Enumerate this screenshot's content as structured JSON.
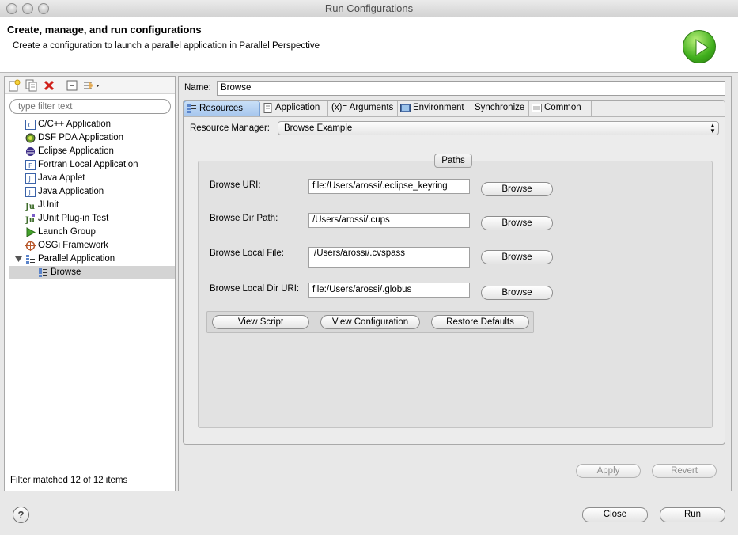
{
  "window": {
    "title": "Run Configurations"
  },
  "header": {
    "title": "Create, manage, and run configurations",
    "subtitle": "Create a configuration to launch a parallel application in Parallel Perspective",
    "icon": "run-play-icon"
  },
  "left": {
    "toolbar": {
      "icons": [
        "new-config-icon",
        "duplicate-icon",
        "delete-icon",
        "collapse-all-icon",
        "filter-menu-icon"
      ]
    },
    "filter_placeholder": "type filter text",
    "tree": [
      {
        "label": "C/C++ Application",
        "icon": "c-app-icon"
      },
      {
        "label": "DSF PDA Application",
        "icon": "dsf-pda-icon"
      },
      {
        "label": "Eclipse Application",
        "icon": "eclipse-icon"
      },
      {
        "label": "Fortran Local Application",
        "icon": "fortran-icon"
      },
      {
        "label": "Java Applet",
        "icon": "java-applet-icon"
      },
      {
        "label": "Java Application",
        "icon": "java-app-icon"
      },
      {
        "label": "JUnit",
        "icon": "junit-icon"
      },
      {
        "label": "JUnit Plug-in Test",
        "icon": "junit-plugin-icon"
      },
      {
        "label": "Launch Group",
        "icon": "launch-group-icon"
      },
      {
        "label": "OSGi Framework",
        "icon": "osgi-icon"
      },
      {
        "label": "Parallel Application",
        "icon": "parallel-app-icon",
        "expanded": true
      },
      {
        "label": "Browse",
        "icon": "parallel-config-icon",
        "selected": true
      }
    ],
    "status": "Filter matched 12 of 12 items"
  },
  "right": {
    "name_label": "Name:",
    "name_value": "Browse",
    "tabs": [
      {
        "label": "Resources",
        "icon": "resources-icon",
        "active": true
      },
      {
        "label": "Application",
        "icon": "document-icon"
      },
      {
        "label": "(x)= Arguments",
        "icon": ""
      },
      {
        "label": "Environment",
        "icon": "environment-icon"
      },
      {
        "label": "Synchronize",
        "icon": ""
      },
      {
        "label": "Common",
        "icon": "common-icon"
      }
    ],
    "resource_manager_label": "Resource Manager:",
    "resource_manager_value": "Browse Example",
    "paths_title": "Paths",
    "paths": [
      {
        "label": "Browse URI:",
        "value": "file:/Users/arossi/.eclipse_keyring",
        "button": "Browse"
      },
      {
        "label": "Browse Dir Path:",
        "value": "/Users/arossi/.cups",
        "button": "Browse"
      },
      {
        "label": "Browse Local File:",
        "value": "/Users/arossi/.cvspass",
        "button": "Browse"
      },
      {
        "label": "Browse Local Dir URI:",
        "value": "file:/Users/arossi/.globus",
        "button": "Browse"
      }
    ],
    "actions": {
      "view_script": "View Script",
      "view_configuration": "View Configuration",
      "restore_defaults": "Restore Defaults"
    },
    "apply": "Apply",
    "revert": "Revert"
  },
  "footer": {
    "help": "?",
    "close": "Close",
    "run": "Run"
  }
}
